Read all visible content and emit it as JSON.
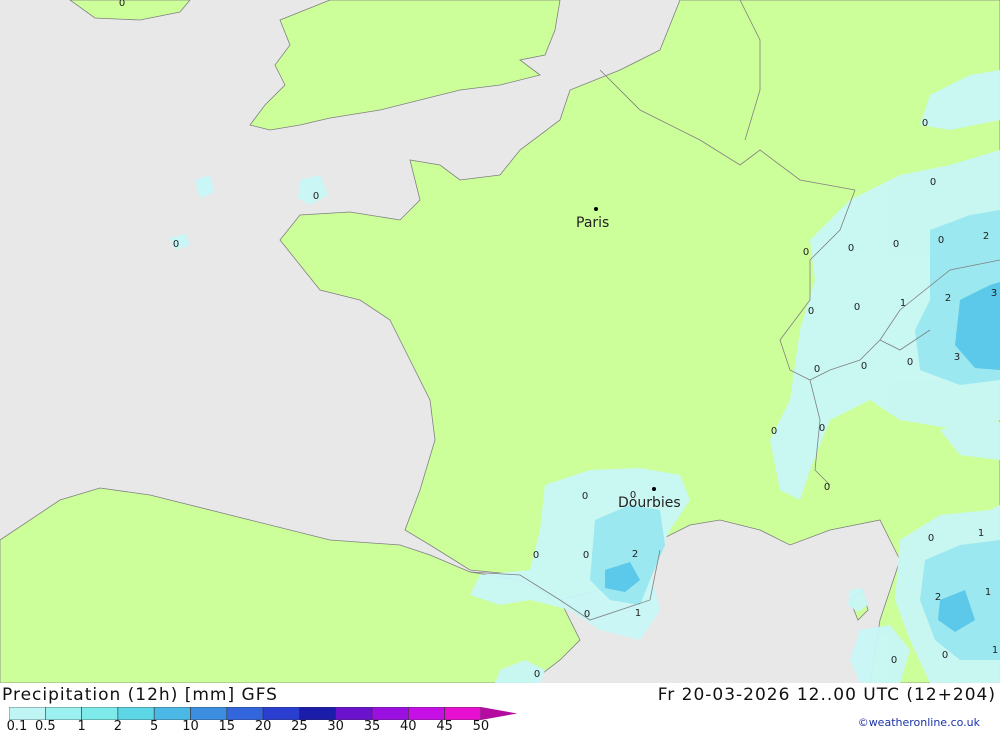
{
  "title": {
    "left": "Precipitation (12h) [mm] GFS",
    "right": "Fr 20-03-2026 12..00 UTC (12+204)"
  },
  "credit": "©weatheronline.co.uk",
  "cities": [
    {
      "name": "Paris"
    },
    {
      "name": "Dourbies"
    }
  ],
  "values": [
    "0",
    "0",
    "0",
    "0",
    "0",
    "0",
    "0",
    "0",
    "2",
    "0",
    "1",
    "2",
    "3",
    "3",
    "0",
    "0",
    "0",
    "0",
    "0",
    "0",
    "0",
    "0",
    "0",
    "0",
    "0",
    "0",
    "2",
    "0",
    "1",
    "0",
    "0",
    "1",
    "2",
    "1",
    "0",
    "0",
    "1"
  ],
  "legend": {
    "labels": [
      "0.1",
      "0.5",
      "1",
      "2",
      "5",
      "10",
      "15",
      "20",
      "25",
      "30",
      "35",
      "40",
      "45",
      "50"
    ],
    "colors": [
      "#bff5f5",
      "#9cf0f0",
      "#7eeaea",
      "#5dd6e6",
      "#4cb8e6",
      "#3c8ee0",
      "#3366dd",
      "#2a3fd0",
      "#1c1caa",
      "#6a12cc",
      "#9a10e0",
      "#c710e6",
      "#e810d0",
      "#b40ca0"
    ]
  },
  "colors": {
    "sea": "#e8e8e8",
    "land": "#ccff99",
    "precip_light": "#c8f7f7",
    "precip_mid": "#9be8f0",
    "precip_heavy": "#5cc8ea",
    "border": "#808080"
  }
}
